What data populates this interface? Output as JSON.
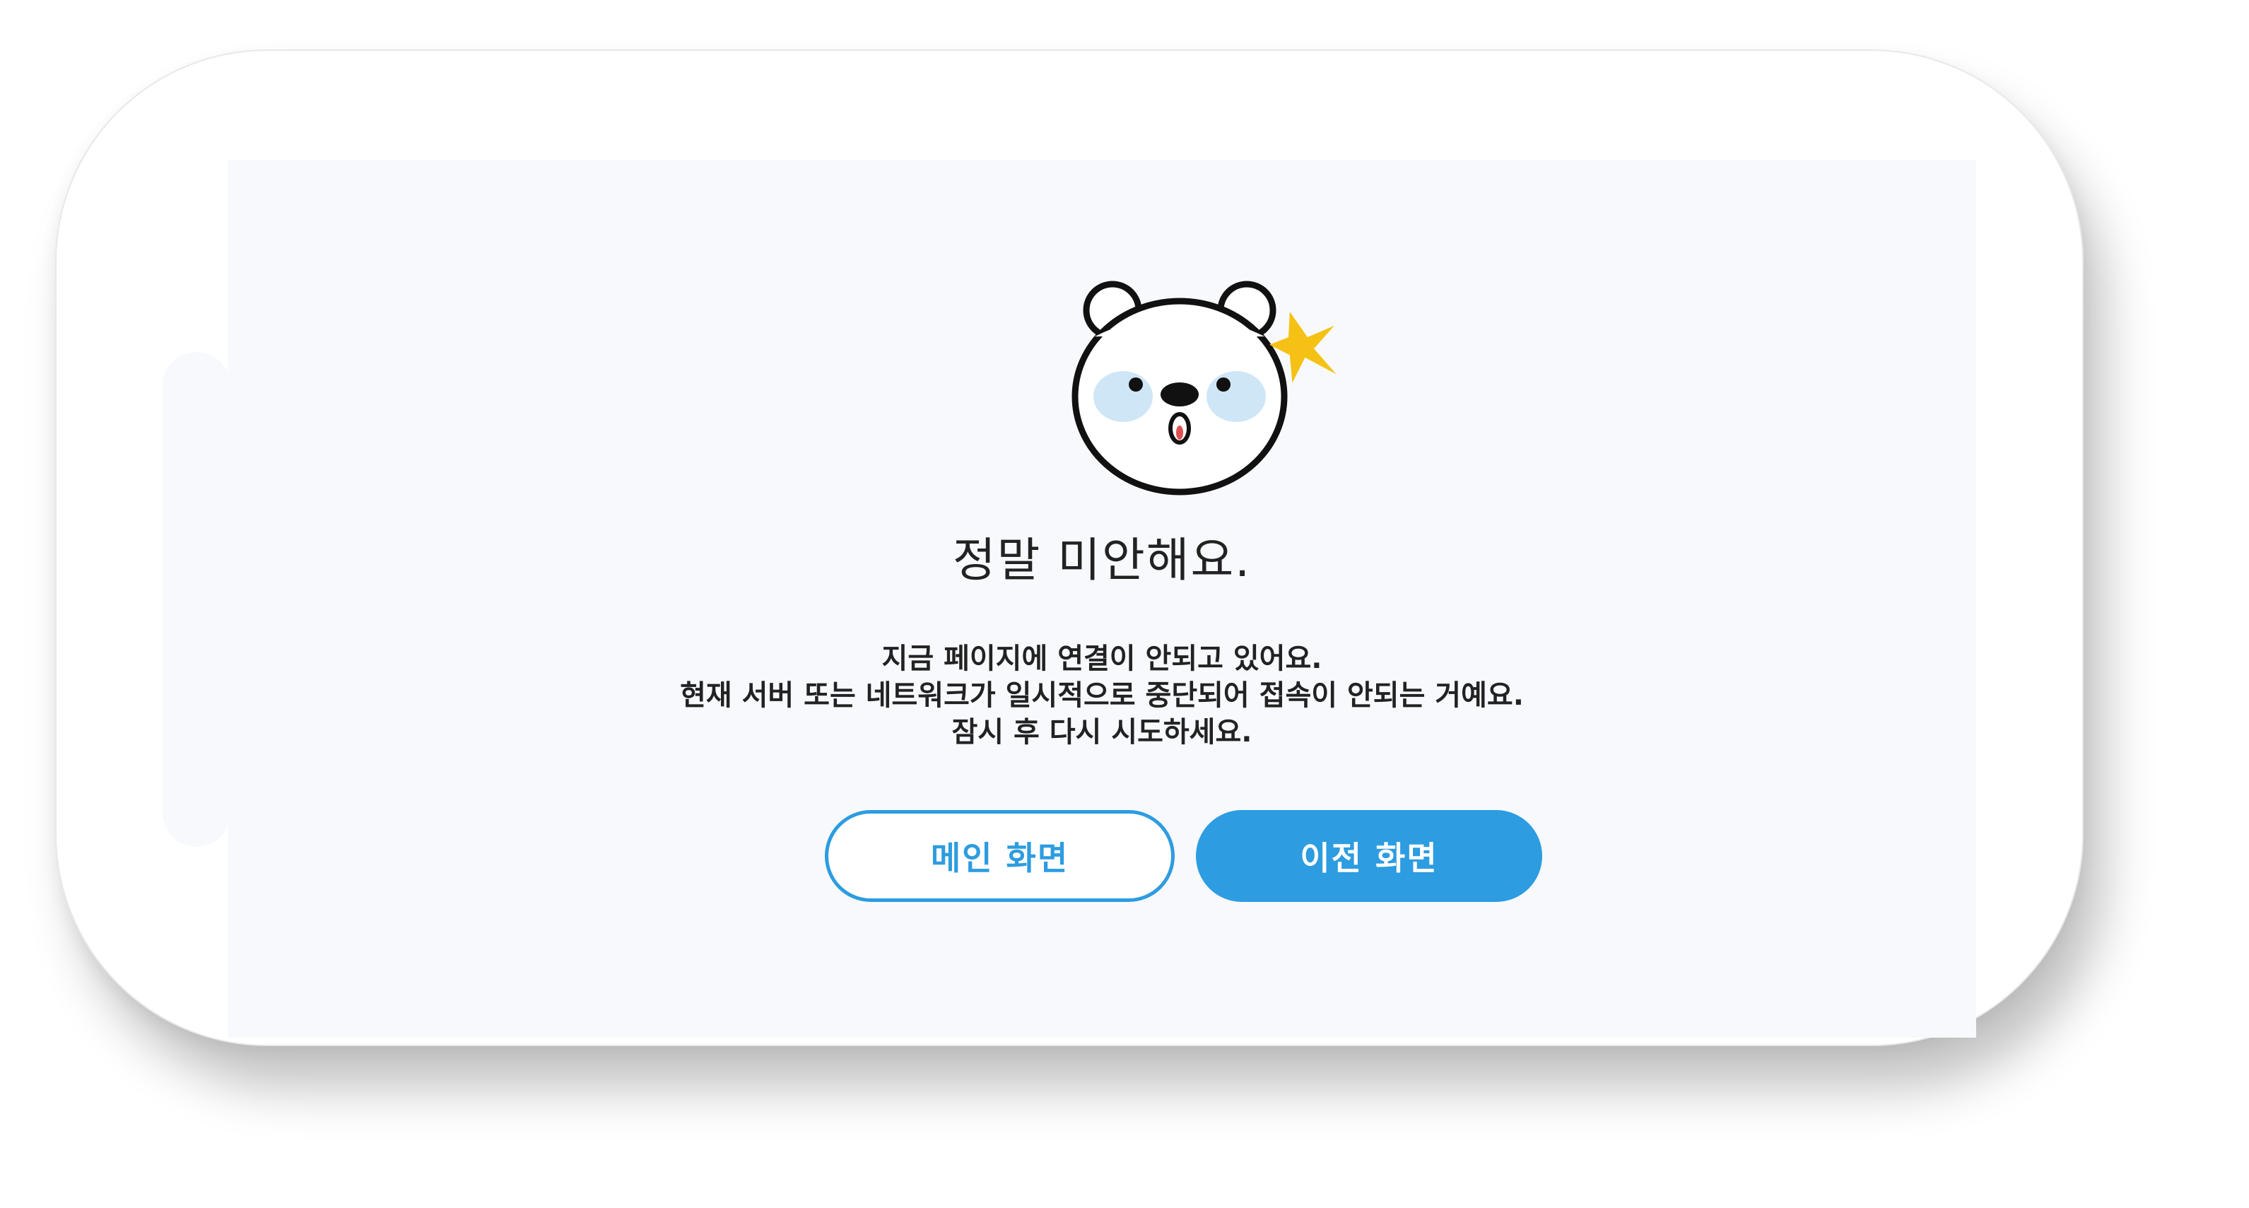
{
  "error_page": {
    "title": "정말 미안해요.",
    "message_lines": [
      "지금 페이지에 연결이 안되고 있어요.",
      "현재 서버 또는 네트워크가 일시적으로 중단되어 접속이 안되는 거예요.",
      "잠시 후 다시 시도하세요."
    ],
    "mascot_icon": "surprised-bear-icon",
    "buttons": {
      "main_label": "메인 화면",
      "prev_label": "이전 화면"
    }
  },
  "colors": {
    "accent": "#2d9ce0",
    "screen_background": "#f7f9fd",
    "text": "#222222",
    "spark": "#f5c115",
    "cheek": "#cfe6f7"
  }
}
